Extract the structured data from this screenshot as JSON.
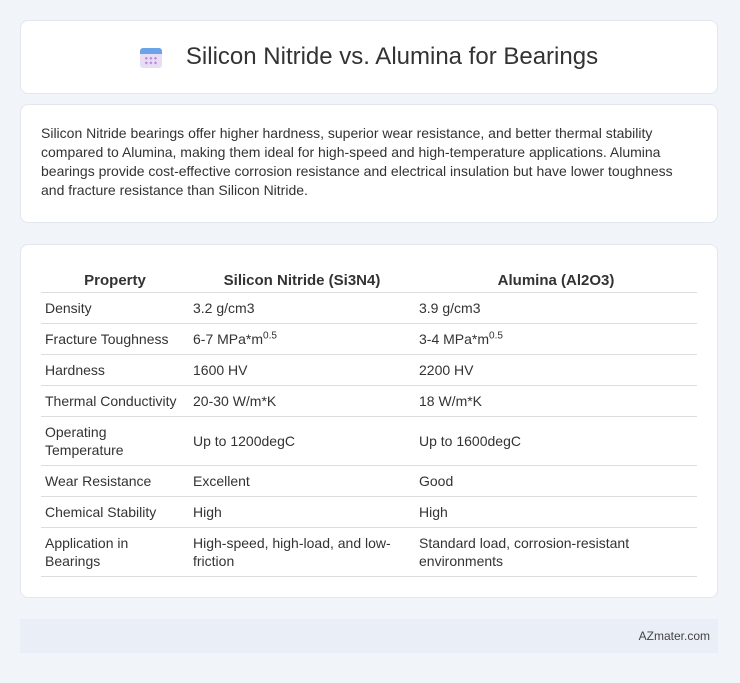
{
  "header": {
    "title": "Silicon Nitride vs. Alumina for Bearings"
  },
  "description": "Silicon Nitride bearings offer higher hardness, superior wear resistance, and better thermal stability compared to Alumina, making them ideal for high-speed and high-temperature applications. Alumina bearings provide cost-effective corrosion resistance and electrical insulation but have lower toughness and fracture resistance than Silicon Nitride.",
  "table": {
    "headers": [
      "Property",
      "Silicon Nitride (Si3N4)",
      "Alumina (Al2O3)"
    ],
    "rows": [
      {
        "property": "Density",
        "si3n4": "3.2 g/cm3",
        "al2o3": "3.9 g/cm3"
      },
      {
        "property": "Fracture Toughness",
        "si3n4": "6-7 MPa*m",
        "si3n4_sup": "0.5",
        "al2o3": "3-4 MPa*m",
        "al2o3_sup": "0.5"
      },
      {
        "property": "Hardness",
        "si3n4": "1600 HV",
        "al2o3": "2200 HV"
      },
      {
        "property": "Thermal Conductivity",
        "si3n4": "20-30 W/m*K",
        "al2o3": "18 W/m*K"
      },
      {
        "property": "Operating Temperature",
        "si3n4": "Up to 1200degC",
        "al2o3": "Up to 1600degC"
      },
      {
        "property": "Wear Resistance",
        "si3n4": "Excellent",
        "al2o3": "Good"
      },
      {
        "property": "Chemical Stability",
        "si3n4": "High",
        "al2o3": "High"
      },
      {
        "property": "Application in Bearings",
        "si3n4": "High-speed, high-load, and low-friction",
        "al2o3": "Standard load, corrosion-resistant environments"
      }
    ]
  },
  "footer": {
    "brand": "AZmater.com"
  },
  "icons": {
    "title_icon": "calendar-icon"
  }
}
